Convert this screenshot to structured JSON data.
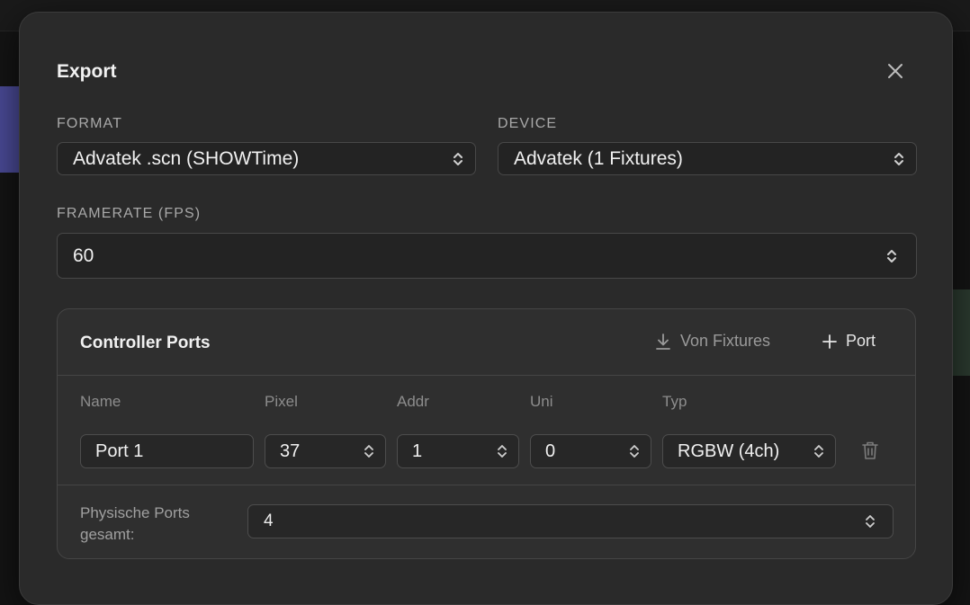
{
  "dialog": {
    "title": "Export",
    "close_icon": "close-icon"
  },
  "format": {
    "label": "FORMAT",
    "value": "Advatek .scn (SHOWTime)"
  },
  "device": {
    "label": "DEVICE",
    "value": "Advatek (1 Fixtures)"
  },
  "framerate": {
    "label": "FRAMERATE (FPS)",
    "value": "60"
  },
  "controller_ports": {
    "title": "Controller Ports",
    "from_fixtures_label": "Von Fixtures",
    "from_fixtures_icon": "download-icon",
    "add_port_label": "Port",
    "add_port_icon": "plus-icon",
    "columns": {
      "name": "Name",
      "pixel": "Pixel",
      "addr": "Addr",
      "uni": "Uni",
      "typ": "Typ"
    },
    "rows": [
      {
        "name": "Port 1",
        "pixel": "37",
        "addr": "1",
        "uni": "0",
        "typ": "RGBW (4ch)"
      }
    ],
    "physical_ports_label": "Physische Ports gesamt:",
    "physical_ports_value": "4"
  },
  "colors": {
    "background": "#141414",
    "dialog": "#2a2a2a",
    "panel": "#2f2f2f",
    "border": "#484848",
    "text": "#f1f1f1",
    "muted": "#a9a9a9"
  }
}
